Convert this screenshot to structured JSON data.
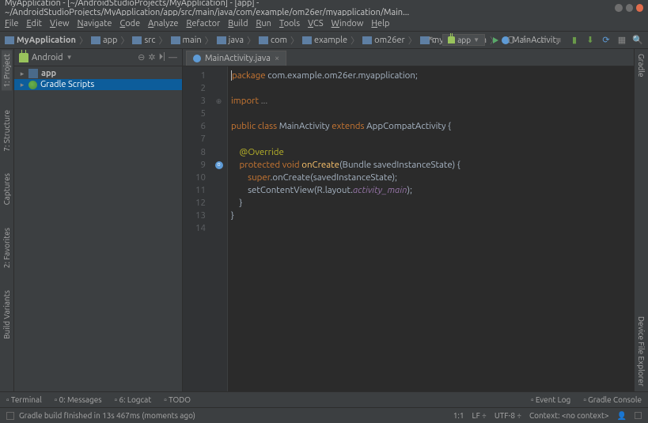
{
  "titlebar": {
    "text": "MyApplication - [~/AndroidStudioProjects/MyApplication] - [app] - ~/AndroidStudioProjects/MyApplication/app/src/main/java/com/example/om26er/myapplication/Main..."
  },
  "menubar": {
    "items": [
      "File",
      "Edit",
      "View",
      "Navigate",
      "Code",
      "Analyze",
      "Refactor",
      "Build",
      "Run",
      "Tools",
      "VCS",
      "Window",
      "Help"
    ]
  },
  "breadcrumbs": [
    "MyApplication",
    "app",
    "src",
    "main",
    "java",
    "com",
    "example",
    "om26er",
    "myapplication",
    "MainActivity"
  ],
  "run_config": "app",
  "left_tool_tabs": [
    "1: Project",
    "7: Structure",
    "Captures",
    "2: Favorites",
    "Build Variants"
  ],
  "right_tool_tabs": [
    "Gradle",
    "Device File Explorer"
  ],
  "project": {
    "view_mode": "Android",
    "items": [
      {
        "label": "app",
        "icon": "module"
      },
      {
        "label": "Gradle Scripts",
        "icon": "gradle"
      }
    ]
  },
  "editor": {
    "tabs": [
      {
        "label": "MainActivity.java"
      }
    ],
    "lines": [
      {
        "n": 1,
        "html": "<span class='kw'>package</span> com.example.om26er.myapplication;"
      },
      {
        "n": 2,
        "html": ""
      },
      {
        "n": 3,
        "html": "<span class='kw'>import</span> <span class='com'>...</span>",
        "fold": true
      },
      {
        "n": 5,
        "html": ""
      },
      {
        "n": 6,
        "html": "<span class='kw'>public class</span> MainActivity <span class='kw'>extends</span> AppCompatActivity {"
      },
      {
        "n": 7,
        "html": ""
      },
      {
        "n": 8,
        "html": "    <span class='ann'>@Override</span>"
      },
      {
        "n": 9,
        "html": "    <span class='kw'>protected void</span> <span class='str'>onCreate</span>(Bundle savedInstanceState) {",
        "override": true
      },
      {
        "n": 10,
        "html": "        <span class='kw'>super</span>.onCreate(savedInstanceState);"
      },
      {
        "n": 11,
        "html": "        setContentView(R.layout.<span class='fld'>activity_main</span>);"
      },
      {
        "n": 12,
        "html": "    }"
      },
      {
        "n": 13,
        "html": "}"
      },
      {
        "n": 14,
        "html": ""
      }
    ]
  },
  "bottom_tabs": [
    "Terminal",
    "0: Messages",
    "6: Logcat",
    "TODO"
  ],
  "bottom_right": [
    "Event Log",
    "Gradle Console"
  ],
  "status": {
    "msg": "Gradle build finished in 13s 467ms (moments ago)",
    "pos": "1:1",
    "le": "LF ÷",
    "enc": "UTF-8 ÷",
    "context": "Context: <no context>"
  }
}
